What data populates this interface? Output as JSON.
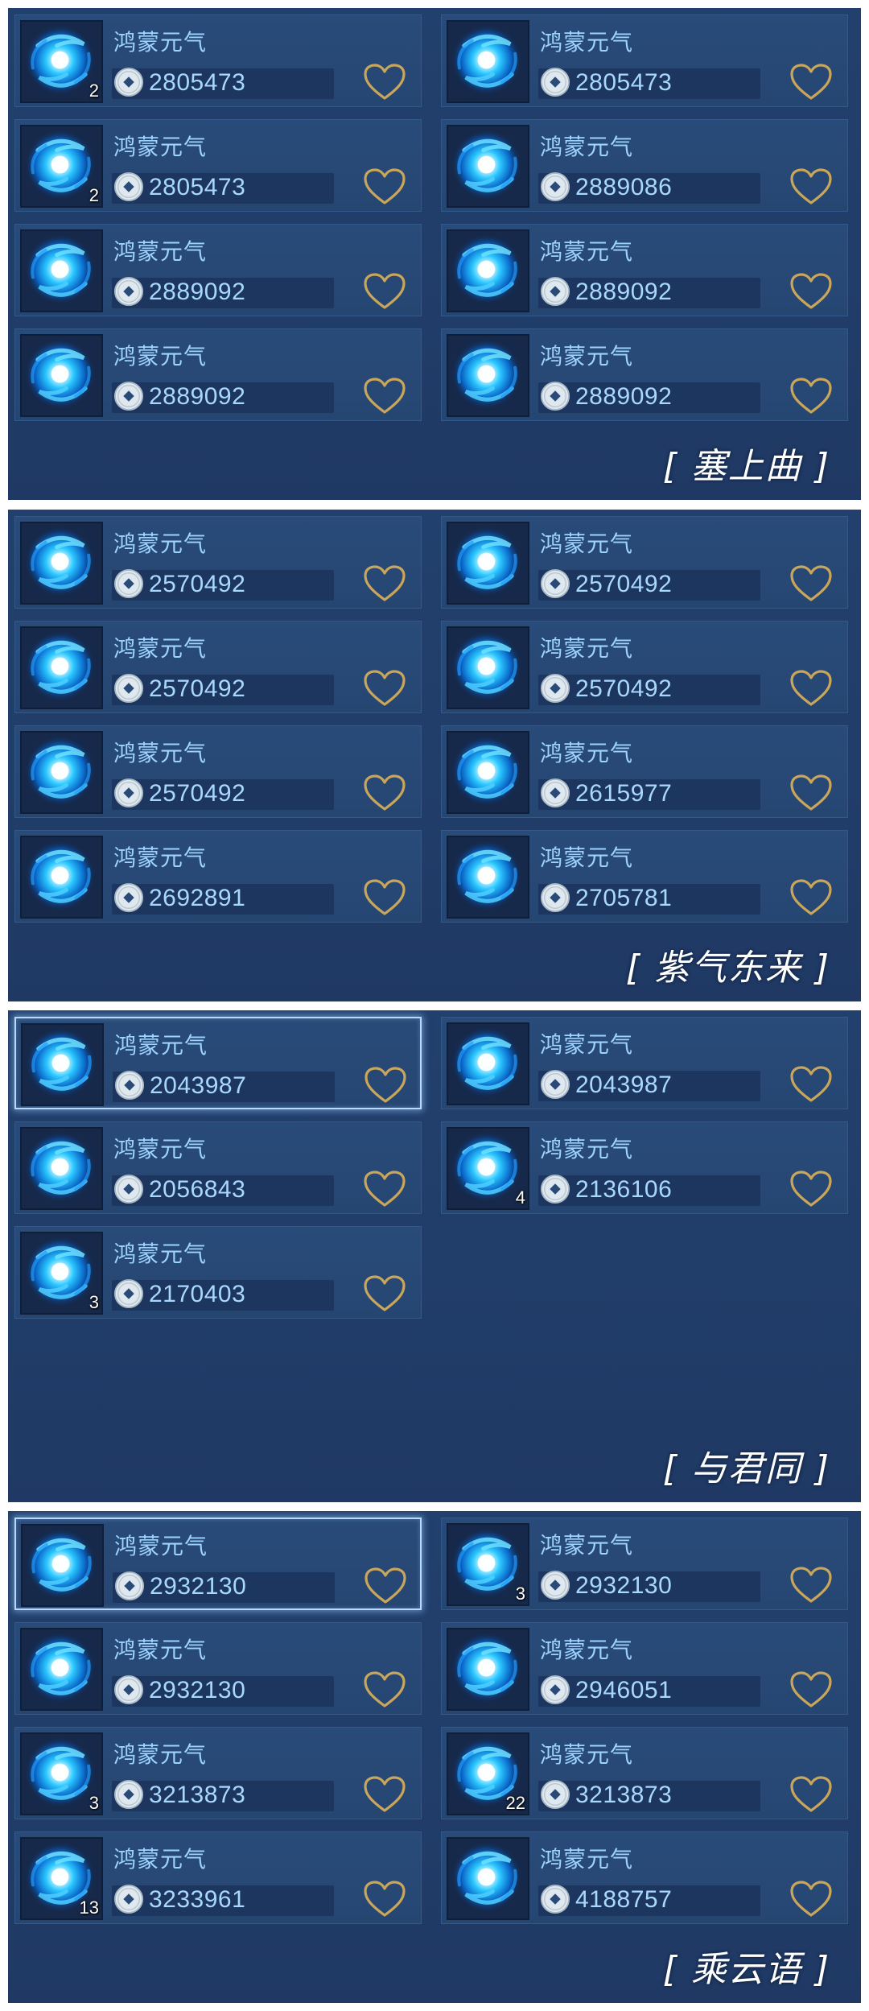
{
  "item_name": "鸿蒙元气",
  "icons": {
    "item": "blue-vortex-icon",
    "currency": "coin-icon",
    "favorite": "heart-outline-icon"
  },
  "colors": {
    "panel": "#213d69",
    "card": "#284a77",
    "text": "#9fd3ff",
    "heart": "#c9a65a",
    "selected_border": "#b8d8ff"
  },
  "sections": [
    {
      "title": "[ 塞上曲 ]",
      "items": [
        {
          "name": "鸿蒙元气",
          "count": "2",
          "price": "2805473",
          "selected": false
        },
        {
          "name": "鸿蒙元气",
          "count": "",
          "price": "2805473",
          "selected": false
        },
        {
          "name": "鸿蒙元气",
          "count": "2",
          "price": "2805473",
          "selected": false
        },
        {
          "name": "鸿蒙元气",
          "count": "",
          "price": "2889086",
          "selected": false
        },
        {
          "name": "鸿蒙元气",
          "count": "",
          "price": "2889092",
          "selected": false
        },
        {
          "name": "鸿蒙元气",
          "count": "",
          "price": "2889092",
          "selected": false
        },
        {
          "name": "鸿蒙元气",
          "count": "",
          "price": "2889092",
          "selected": false
        },
        {
          "name": "鸿蒙元气",
          "count": "",
          "price": "2889092",
          "selected": false
        }
      ]
    },
    {
      "title": "[ 紫气东来 ]",
      "items": [
        {
          "name": "鸿蒙元气",
          "count": "",
          "price": "2570492",
          "selected": false
        },
        {
          "name": "鸿蒙元气",
          "count": "",
          "price": "2570492",
          "selected": false
        },
        {
          "name": "鸿蒙元气",
          "count": "",
          "price": "2570492",
          "selected": false
        },
        {
          "name": "鸿蒙元气",
          "count": "",
          "price": "2570492",
          "selected": false
        },
        {
          "name": "鸿蒙元气",
          "count": "",
          "price": "2570492",
          "selected": false
        },
        {
          "name": "鸿蒙元气",
          "count": "",
          "price": "2615977",
          "selected": false
        },
        {
          "name": "鸿蒙元气",
          "count": "",
          "price": "2692891",
          "selected": false
        },
        {
          "name": "鸿蒙元气",
          "count": "",
          "price": "2705781",
          "selected": false
        }
      ]
    },
    {
      "title": "[ 与君同 ]",
      "items": [
        {
          "name": "鸿蒙元气",
          "count": "",
          "price": "2043987",
          "selected": true
        },
        {
          "name": "鸿蒙元气",
          "count": "",
          "price": "2043987",
          "selected": false
        },
        {
          "name": "鸿蒙元气",
          "count": "",
          "price": "2056843",
          "selected": false
        },
        {
          "name": "鸿蒙元气",
          "count": "4",
          "price": "2136106",
          "selected": false
        },
        {
          "name": "鸿蒙元气",
          "count": "3",
          "price": "2170403",
          "selected": false
        }
      ]
    },
    {
      "title": "[ 乘云语 ]",
      "items": [
        {
          "name": "鸿蒙元气",
          "count": "",
          "price": "2932130",
          "selected": true
        },
        {
          "name": "鸿蒙元气",
          "count": "3",
          "price": "2932130",
          "selected": false
        },
        {
          "name": "鸿蒙元气",
          "count": "",
          "price": "2932130",
          "selected": false
        },
        {
          "name": "鸿蒙元气",
          "count": "",
          "price": "2946051",
          "selected": false
        },
        {
          "name": "鸿蒙元气",
          "count": "3",
          "price": "3213873",
          "selected": false
        },
        {
          "name": "鸿蒙元气",
          "count": "22",
          "price": "3213873",
          "selected": false
        },
        {
          "name": "鸿蒙元气",
          "count": "13",
          "price": "3233961",
          "selected": false
        },
        {
          "name": "鸿蒙元气",
          "count": "",
          "price": "4188757",
          "selected": false
        }
      ]
    }
  ]
}
